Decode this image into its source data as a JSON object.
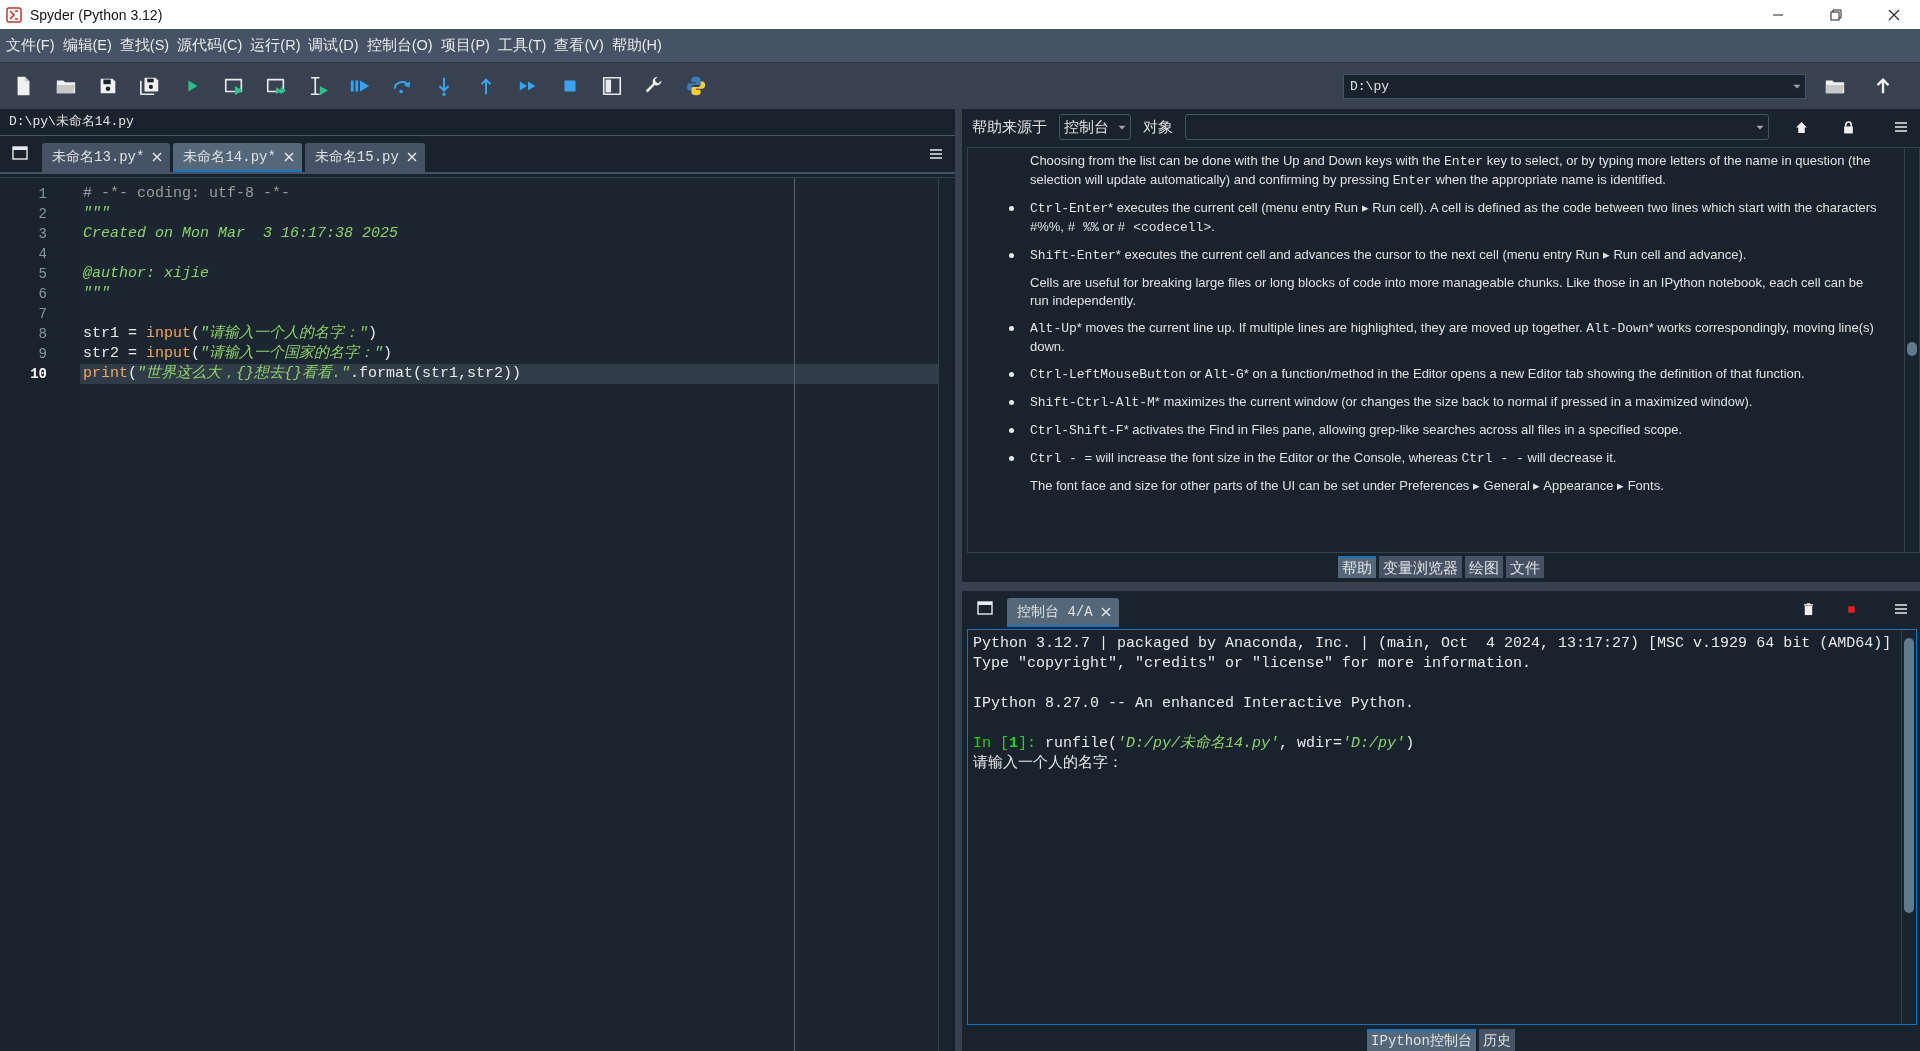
{
  "window": {
    "title": "Spyder (Python 3.12)"
  },
  "menu": [
    "文件(F)",
    "编辑(E)",
    "查找(S)",
    "源代码(C)",
    "运行(R)",
    "调试(D)",
    "控制台(O)",
    "项目(P)",
    "工具(T)",
    "查看(V)",
    "帮助(H)"
  ],
  "path_field": {
    "value": "D:\\py"
  },
  "editor": {
    "file_path": "D:\\py\\未命名14.py",
    "tabs": [
      {
        "label": "未命名13.py*",
        "selected": false
      },
      {
        "label": "未命名14.py*",
        "selected": true
      },
      {
        "label": "未命名15.py",
        "selected": false
      }
    ],
    "lines": [
      {
        "number": "1",
        "current": false,
        "tokens": [
          {
            "kind": "comment",
            "text": "# -*- coding: utf-8 -*-"
          }
        ]
      },
      {
        "number": "2",
        "current": false,
        "tokens": [
          {
            "kind": "doc",
            "text": "\"\"\""
          }
        ]
      },
      {
        "number": "3",
        "current": false,
        "tokens": [
          {
            "kind": "doc",
            "text": "Created on Mon Mar  3 16:17:38 2025"
          }
        ]
      },
      {
        "number": "4",
        "current": false
      },
      {
        "number": "5",
        "current": false,
        "tokens": [
          {
            "kind": "doc",
            "text": "@author: xijie"
          }
        ]
      },
      {
        "number": "6",
        "current": false,
        "tokens": [
          {
            "kind": "doc",
            "text": "\"\"\""
          }
        ]
      },
      {
        "number": "7",
        "current": false
      },
      {
        "number": "8",
        "current": false,
        "tokens": [
          {
            "kind": "plain",
            "text": "str1 = "
          },
          {
            "kind": "builtin",
            "text": "input"
          },
          {
            "kind": "plain",
            "text": "("
          },
          {
            "kind": "string",
            "text": "\"请输入一个人的名字：\""
          },
          {
            "kind": "plain",
            "text": ")"
          }
        ]
      },
      {
        "number": "9",
        "current": false,
        "tokens": [
          {
            "kind": "plain",
            "text": "str2 = "
          },
          {
            "kind": "builtin",
            "text": "input"
          },
          {
            "kind": "plain",
            "text": "("
          },
          {
            "kind": "string",
            "text": "\"请输入一个国家的名字：\""
          },
          {
            "kind": "plain",
            "text": ")"
          }
        ]
      },
      {
        "number": "10",
        "current": true,
        "tokens": [
          {
            "kind": "builtin",
            "text": "print"
          },
          {
            "kind": "plain",
            "text": "("
          },
          {
            "kind": "string",
            "text": "\"世界这么大，{}想去{}看看.\""
          },
          {
            "kind": "plain",
            "text": ".format(str1,str2))"
          }
        ]
      }
    ]
  },
  "help": {
    "source_label": "帮助来源于",
    "source": "控制台",
    "object_label": "对象",
    "paragraphs": [
      {
        "kind": "para",
        "segments": [
          {
            "kind": "text",
            "text": "Choosing from the list can be done with the Up and Down keys with the "
          },
          {
            "kind": "code",
            "text": "Enter"
          },
          {
            "kind": "text",
            "text": " key to select, or by typing more letters of the name in question (the selection will update automatically) and confirming by pressing "
          },
          {
            "kind": "code",
            "text": "Enter"
          },
          {
            "kind": "text",
            "text": " when the appropriate name is identified."
          }
        ]
      },
      {
        "kind": "bullet",
        "segments": [
          {
            "kind": "code",
            "text": "Ctrl-Enter"
          },
          {
            "kind": "text",
            "text": "* executes the current cell (menu entry Run ▸ Run cell). A cell is defined as the code between two lines which start with the characters #%%, "
          },
          {
            "kind": "code",
            "text": "# %%"
          },
          {
            "kind": "text",
            "text": " or "
          },
          {
            "kind": "code",
            "text": "# <codecell>"
          },
          {
            "kind": "text",
            "text": "."
          }
        ]
      },
      {
        "kind": "bullet",
        "segments": [
          {
            "kind": "code",
            "text": "Shift-Enter"
          },
          {
            "kind": "text",
            "text": "* executes the current cell and advances the cursor to the next cell (menu entry Run ▸ Run cell and advance)."
          }
        ]
      },
      {
        "kind": "para",
        "segments": [
          {
            "kind": "text",
            "text": "Cells are useful for breaking large files or long blocks of code into more manageable chunks. Like those in an IPython notebook, each cell can be run independently."
          }
        ]
      },
      {
        "kind": "bullet",
        "segments": [
          {
            "kind": "code",
            "text": "Alt-Up"
          },
          {
            "kind": "text",
            "text": "* moves the current line up. If multiple lines are highlighted, they are moved up together. "
          },
          {
            "kind": "code",
            "text": "Alt-Down"
          },
          {
            "kind": "text",
            "text": "* works correspondingly, moving line(s) down."
          }
        ]
      },
      {
        "kind": "bullet",
        "segments": [
          {
            "kind": "code",
            "text": "Ctrl-LeftMouseButton"
          },
          {
            "kind": "text",
            "text": " or "
          },
          {
            "kind": "code",
            "text": "Alt-G"
          },
          {
            "kind": "text",
            "text": "* on a function/method in the Editor opens a new Editor tab showing the definition of that function."
          }
        ]
      },
      {
        "kind": "bullet",
        "segments": [
          {
            "kind": "code",
            "text": "Shift-Ctrl-Alt-M"
          },
          {
            "kind": "text",
            "text": "* maximizes the current window (or changes the size back to normal if pressed in a maximized window)."
          }
        ]
      },
      {
        "kind": "bullet",
        "segments": [
          {
            "kind": "code",
            "text": "Ctrl-Shift-F"
          },
          {
            "kind": "text",
            "text": "* activates the Find in Files pane, allowing grep-like searches across all files in a specified scope."
          }
        ]
      },
      {
        "kind": "bullet",
        "segments": [
          {
            "kind": "code",
            "text": "Ctrl - "
          },
          {
            "kind": "text",
            "text": "= will increase the font size in the Editor or the Console, whereas "
          },
          {
            "kind": "code",
            "text": "Ctrl - -"
          },
          {
            "kind": "text",
            "text": " will decrease it."
          }
        ]
      },
      {
        "kind": "para",
        "segments": [
          {
            "kind": "text",
            "text": "The font face and size for other parts of the UI can be set under Preferences ▸ General ▸ Appearance ▸ Fonts."
          }
        ]
      }
    ]
  },
  "plugin_tabs": [
    {
      "label": "帮助",
      "selected": true
    },
    {
      "label": "变量浏览器",
      "selected": false
    },
    {
      "label": "绘图",
      "selected": false
    },
    {
      "label": "文件",
      "selected": false
    }
  ],
  "console": {
    "tabs": [
      {
        "label": "控制台 4/A",
        "selected": true
      }
    ],
    "lines": [
      {
        "blank_before": false,
        "tokens": [
          {
            "kind": "plain",
            "text": "Python 3.12.7 | packaged by Anaconda, Inc. | (main, Oct  4 2024, 13:17:27) [MSC v.1929 64 bit (AMD64)]"
          }
        ]
      },
      {
        "blank_before": false,
        "tokens": [
          {
            "kind": "plain",
            "text": "Type \"copyright\", \"credits\" or \"license\" for more information."
          }
        ]
      },
      {
        "blank_before": true,
        "tokens": [
          {
            "kind": "plain",
            "text": "IPython 8.27.0 -- An enhanced Interactive Python."
          }
        ]
      },
      {
        "blank_before": true,
        "tokens": [
          {
            "kind": "prompt",
            "text": "In ["
          },
          {
            "kind": "prompt_number",
            "text": "1"
          },
          {
            "kind": "prompt",
            "text": "]: "
          },
          {
            "kind": "plain",
            "text": "runfile("
          },
          {
            "kind": "string",
            "text": "'D:/py/未命名14.py'"
          },
          {
            "kind": "plain",
            "text": ", wdir="
          },
          {
            "kind": "string",
            "text": "'D:/py'"
          },
          {
            "kind": "plain",
            "text": ")"
          }
        ]
      },
      {
        "blank_before": false,
        "tokens": [
          {
            "kind": "plain",
            "text": "请输入一个人的名字："
          }
        ]
      }
    ]
  },
  "console_plugin_tabs": [
    {
      "label": "IPython控制台",
      "selected": true
    },
    {
      "label": "历史",
      "selected": false
    }
  ]
}
